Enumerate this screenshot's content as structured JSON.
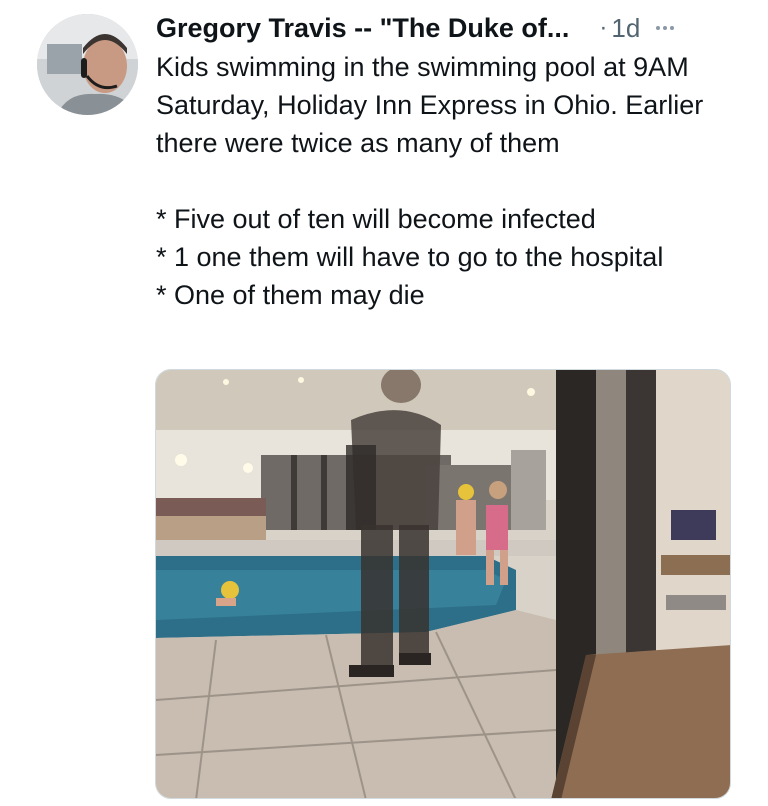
{
  "tweet": {
    "author_name": "Gregory Travis -- \"The Duke of...",
    "separator": "·",
    "timestamp": "1d",
    "more_icon": "more-horizontal-icon",
    "text_lines": [
      "Kids swimming in the swimming pool at 9AM Saturday, Holiday Inn Express in Ohio.  Earlier there were twice as many of them",
      "",
      "* Five out of ten will become infected",
      "* 1 one them will have to go to the hospital",
      "* One of them may die"
    ]
  },
  "colors": {
    "text_primary": "#0f1419",
    "text_secondary": "#536471",
    "border": "#cfd9de"
  }
}
